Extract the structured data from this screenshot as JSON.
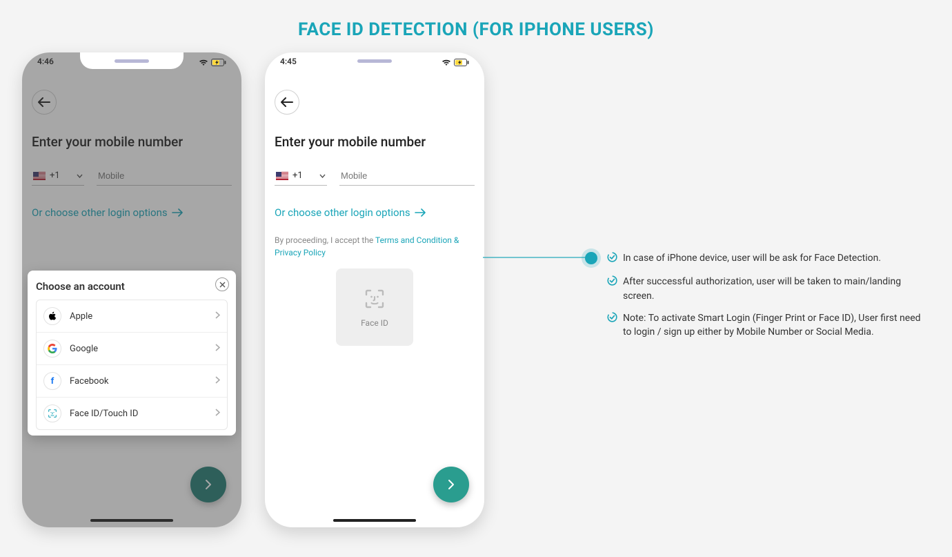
{
  "page_title": "FACE ID DETECTION (FOR IPHONE USERS)",
  "status_time_1": "4:46",
  "status_time_2": "4:45",
  "phone": {
    "heading": "Enter your mobile number",
    "country_code": "+1",
    "mobile_placeholder": "Mobile",
    "alt_login_link": "Or choose other login options",
    "terms_prefix": "By proceeding, I accept the ",
    "terms_link": "Terms and Condition & Privacy Policy"
  },
  "faceid_label": "Face ID",
  "sheet": {
    "title": "Choose an account",
    "items": [
      {
        "label": "Apple"
      },
      {
        "label": "Google"
      },
      {
        "label": "Facebook"
      },
      {
        "label": "Face ID/Touch ID"
      }
    ]
  },
  "notes": [
    "In case of iPhone device, user will be ask for Face Detection.",
    "After successful authorization, user will be taken to main/landing screen.",
    "Note: To activate Smart Login (Finger Print or Face ID), User first need to login / sign up either by Mobile Number or Social Media."
  ]
}
